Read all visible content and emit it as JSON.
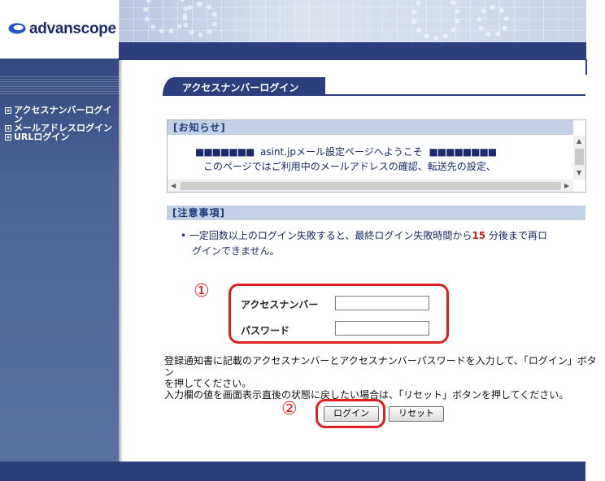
{
  "header": {
    "logo_text": "advanscope"
  },
  "sidebar": {
    "items": [
      {
        "label": "アクセスナンバーログイン",
        "icon": "plus-box-icon"
      },
      {
        "label": "メールアドレスログイン",
        "icon": "plus-box-icon"
      },
      {
        "label": "URLログイン",
        "icon": "plus-box-icon"
      }
    ]
  },
  "main": {
    "page_title": "アクセスナンバーログイン",
    "notice_heading": "[お知らせ]",
    "notice_line1_squares_left": "■■■■■■■",
    "notice_line1_text": "asint.jpメール設定ページへようこそ",
    "notice_line1_squares_right": "■■■■■■■■",
    "notice_line2": "このページではご利用中のメールアドレスの確認、転送先の設定、",
    "caution_heading": "[注意事項]",
    "caution_bullet_prefix": "•  一定回数以上のログイン失敗すると、最終ログイン失敗時間から",
    "caution_minutes": "15",
    "caution_bullet_suffix": " 分後まで再ロ",
    "caution_bullet_line2": "グインできません。",
    "annotation_1": "①",
    "annotation_2": "②",
    "form": {
      "access_number_label": "アクセスナンバー",
      "access_number_value": "",
      "password_label": "パスワード",
      "password_value": ""
    },
    "help_line1": "登録通知書に記載のアクセスナンバーとアクセスナンバーパスワードを入力して、「ログイン」ボタン",
    "help_line2": "を押してください。",
    "help_line3": "入力欄の値を画面表示直後の状態に戻したい場合は、「リセット」ボタンを押してください。",
    "login_button": "ログイン",
    "reset_button": "リセット"
  },
  "colors": {
    "navy": "#2c3e7c",
    "sidebar": "#4c6396",
    "section_bg": "#c3d1e6",
    "annotation_red": "#e02020"
  }
}
